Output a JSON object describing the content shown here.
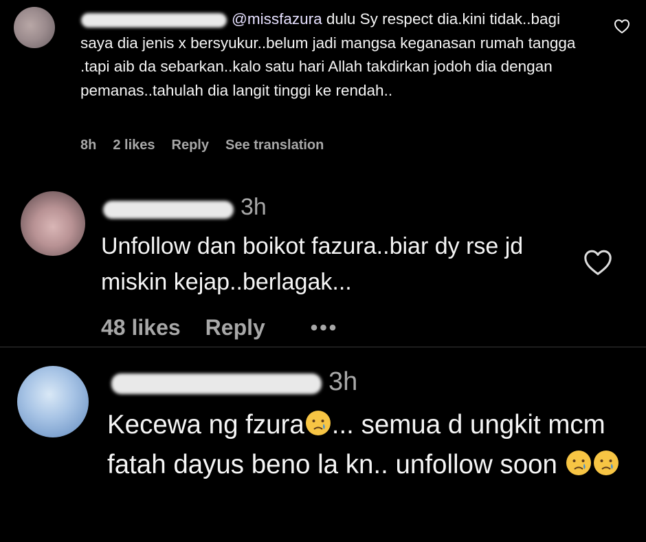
{
  "comments": [
    {
      "mention": "@missfazura",
      "body": " dulu Sy respect dia.kini tidak..bagi saya dia jenis x bersyukur..belum jadi mangsa keganasan rumah tangga .tapi aib da sebarkan..kalo satu hari Allah takdirkan jodoh dia dengan pemanas..tahulah dia langit tinggi ke rendah..",
      "time": "8h",
      "likes": "2 likes",
      "reply": "Reply",
      "translate": "See translation"
    },
    {
      "time": "3h",
      "body": "Unfollow dan boikot fazura..biar dy rse jd miskin kejap..berlagak...",
      "likes": "48 likes",
      "reply": "Reply",
      "more": "•••"
    },
    {
      "time": "3h",
      "body_part1": "Kecewa ng fzura",
      "body_part2": "... semua d ungkit mcm fatah dayus beno la kn.. unfollow soon ",
      "emoji": "crying-face"
    }
  ],
  "colors": {
    "background": "#000000",
    "text": "#f5f5f5",
    "meta": "#a8a8a8",
    "divider": "#3a3a3a"
  },
  "icons": [
    "heart-outline-icon",
    "more-options-icon",
    "crying-face-emoji"
  ]
}
